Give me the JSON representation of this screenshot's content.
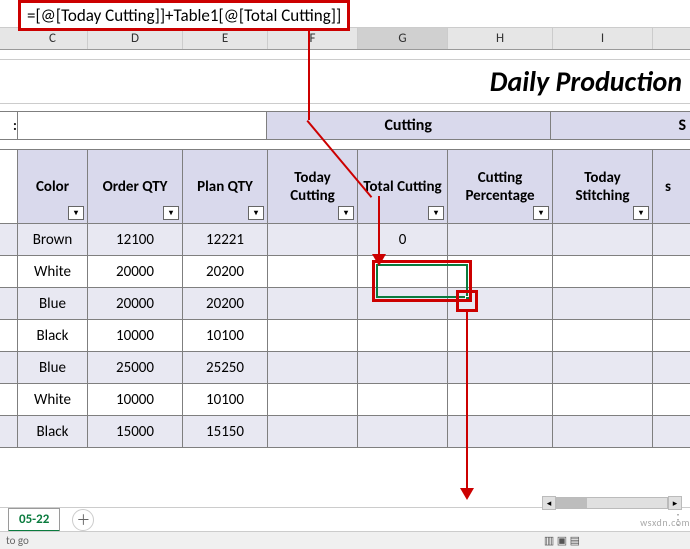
{
  "formula": "=[@[Today Cutting]]+Table1[@[Total Cutting]]",
  "columns": {
    "C": "C",
    "D": "D",
    "E": "E",
    "F": "F",
    "G": "G",
    "H": "H",
    "I": "I"
  },
  "title": "Daily Production",
  "group_headers": {
    "left_colon": ":",
    "cutting": "Cutting",
    "stitching": "S"
  },
  "headers": {
    "color": "Color",
    "order_qty": "Order QTY",
    "plan_qty": "Plan QTY",
    "today_cutting": "Today Cutting",
    "total_cutting": "Total Cutting",
    "cutting_percentage": "Cutting Percentage",
    "today_stitching": "Today Stitching",
    "stitch_col2": "s"
  },
  "rows": [
    {
      "color": "Brown",
      "order_qty": "12100",
      "plan_qty": "12221",
      "today_cutting": "",
      "total_cutting": "0",
      "cutting_percentage": "",
      "today_stitching": ""
    },
    {
      "color": "White",
      "order_qty": "20000",
      "plan_qty": "20200",
      "today_cutting": "",
      "total_cutting": "",
      "cutting_percentage": "",
      "today_stitching": ""
    },
    {
      "color": "Blue",
      "order_qty": "20000",
      "plan_qty": "20200",
      "today_cutting": "",
      "total_cutting": "",
      "cutting_percentage": "",
      "today_stitching": ""
    },
    {
      "color": "Black",
      "order_qty": "10000",
      "plan_qty": "10100",
      "today_cutting": "",
      "total_cutting": "",
      "cutting_percentage": "",
      "today_stitching": ""
    },
    {
      "color": "Blue",
      "order_qty": "25000",
      "plan_qty": "25250",
      "today_cutting": "",
      "total_cutting": "",
      "cutting_percentage": "",
      "today_stitching": ""
    },
    {
      "color": "White",
      "order_qty": "10000",
      "plan_qty": "10100",
      "today_cutting": "",
      "total_cutting": "",
      "cutting_percentage": "",
      "today_stitching": ""
    },
    {
      "color": "Black",
      "order_qty": "15000",
      "plan_qty": "15150",
      "today_cutting": "",
      "total_cutting": "",
      "cutting_percentage": "",
      "today_stitching": ""
    }
  ],
  "sheet_tab": "05-22",
  "status": "to go",
  "watermark": "wsxdn.com",
  "scroll_hint": "⋮"
}
